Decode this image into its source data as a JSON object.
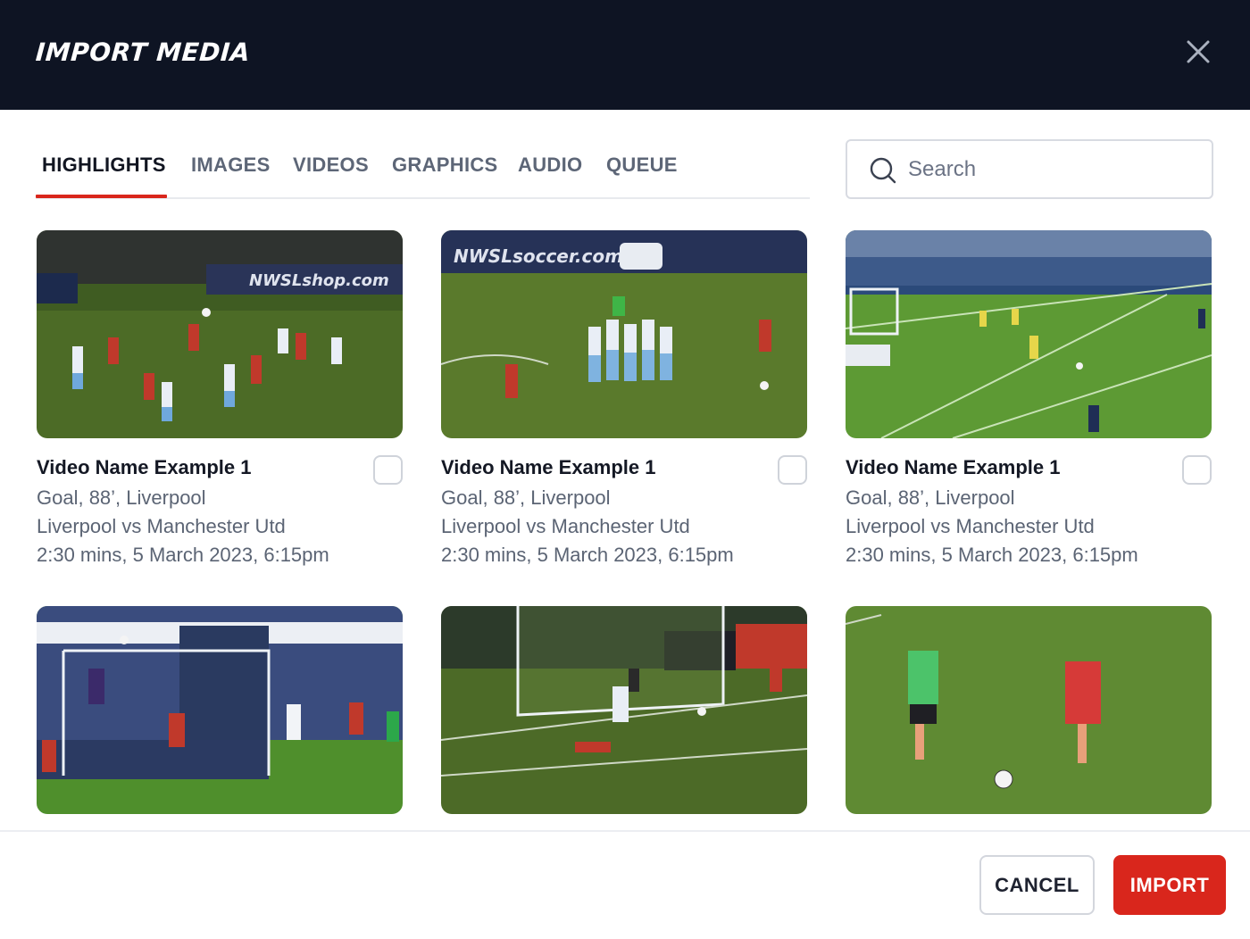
{
  "modal": {
    "title": "IMPORT MEDIA",
    "close_icon": "close-icon"
  },
  "tabs": [
    {
      "label": "HIGHLIGHTS",
      "active": true
    },
    {
      "label": "IMAGES",
      "active": false
    },
    {
      "label": "VIDEOS",
      "active": false
    },
    {
      "label": "GRAPHICS",
      "active": false
    },
    {
      "label": "AUDIO",
      "active": false
    },
    {
      "label": "QUEUE",
      "active": false
    }
  ],
  "search": {
    "placeholder": "Search",
    "value": "",
    "icon": "search-icon"
  },
  "media": [
    {
      "title": "Video Name Example 1",
      "event": "Goal, 88’, Liverpool",
      "match": "Liverpool vs Manchester Utd",
      "meta": "2:30 mins, 5 March 2023, 6:15pm",
      "checked": false,
      "thumbnail": "soccer-players-penalty-area",
      "banner": "NWSLshop.com"
    },
    {
      "title": "Video Name Example 1",
      "event": "Goal, 88’, Liverpool",
      "match": "Liverpool vs Manchester Utd",
      "meta": "2:30 mins, 5 March 2023, 6:15pm",
      "checked": false,
      "thumbnail": "team-celebration-huddle",
      "banner": "NWSLsoccer.com"
    },
    {
      "title": "Video Name Example 1",
      "event": "Goal, 88’, Liverpool",
      "match": "Liverpool vs Manchester Utd",
      "meta": "2:30 mins, 5 March 2023, 6:15pm",
      "checked": false,
      "thumbnail": "stadium-wide-shot",
      "banner": ""
    },
    {
      "title": "",
      "event": "",
      "match": "",
      "meta": "",
      "checked": false,
      "thumbnail": "goalkeeper-save",
      "banner": ""
    },
    {
      "title": "",
      "event": "",
      "match": "",
      "meta": "",
      "checked": false,
      "thumbnail": "goal-net-scramble",
      "banner": ""
    },
    {
      "title": "",
      "event": "",
      "match": "",
      "meta": "",
      "checked": false,
      "thumbnail": "players-chasing-ball",
      "banner": ""
    }
  ],
  "footer": {
    "cancel_label": "CANCEL",
    "import_label": "IMPORT"
  },
  "colors": {
    "header_bg": "#0e1423",
    "accent": "#d9261c",
    "pitch": "#4f7a2a"
  }
}
